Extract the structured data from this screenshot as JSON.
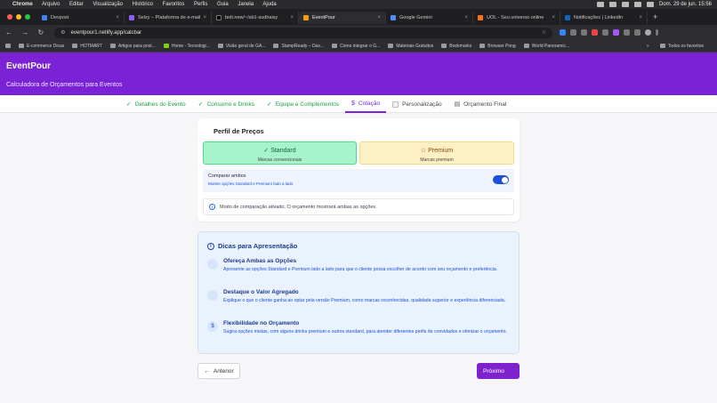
{
  "mac": {
    "menu": [
      "Chrome",
      "Arquivo",
      "Editar",
      "Visualização",
      "Histórico",
      "Favoritos",
      "Perfis",
      "Guia",
      "Janela",
      "Ajuda"
    ],
    "clock": "Dom. 29 de jun.  15:56"
  },
  "tabs": [
    {
      "label": "Devpost",
      "color": "#3b82f6"
    },
    {
      "label": "Selzy – Plataforma de e-mail",
      "color": "#8b5cf6"
    },
    {
      "label": "bolt.new/~/sb1-sudhaisy",
      "color": "#111111"
    },
    {
      "label": "EventPour",
      "color": "#f59e0b"
    },
    {
      "label": "Google Gemini",
      "color": "#4f8ef7"
    },
    {
      "label": "UOL - Seu universo online",
      "color": "#f97316"
    },
    {
      "label": "Notificações | LinkedIn",
      "color": "#0a66c2"
    }
  ],
  "address": {
    "url": "eventpour1.netlify.app/calcbar"
  },
  "bookmarks": [
    "E-commerce Dicas",
    "HOTMART",
    "Artigos para post...",
    "Home - Tecnologi...",
    "Visão geral de GA...",
    "StampReady – Das...",
    "Como integrar o G...",
    "Materiais Gratuitos",
    "Bookmarks",
    "Browser Pong",
    "World Panoramic..."
  ],
  "bookmarks_right": {
    "more": "»",
    "all": "Todos os favoritos"
  },
  "app": {
    "brand": "EventPour",
    "subtitle": "Calculadora de Orçamentos para Eventos"
  },
  "steps": [
    {
      "label": "Detalhes do Evento",
      "state": "done"
    },
    {
      "label": "Consumo e Drinks",
      "state": "done"
    },
    {
      "label": "Equipe e Complementos",
      "state": "done"
    },
    {
      "label": "Cotação",
      "state": "current"
    },
    {
      "label": "Personalização",
      "state": "todo"
    },
    {
      "label": "Orçamento Final",
      "state": "todo"
    }
  ],
  "pricing": {
    "title": "Perfil de Preços",
    "standard": {
      "name": "Standard",
      "desc": "Marcas convencionais"
    },
    "premium": {
      "name": "Premium",
      "desc": "Marcas premium"
    },
    "compare": {
      "label": "Comparar ambos",
      "desc": "Mostre opções Standard e Premium lado a lado",
      "enabled": true
    },
    "note": "Modo de comparação ativado. O orçamento mostrará ambas as opções."
  },
  "tips": {
    "title": "Dicas para Apresentação",
    "items": [
      {
        "title": "Ofereça Ambas as Opções",
        "text": "Apresente as opções Standard e Premium lado a lado para que o cliente possa escolher de acordo com seu orçamento e preferência."
      },
      {
        "title": "Destaque o Valor Agregado",
        "text": "Explique o que o cliente ganha ao optar pela versão Premium, como marcas reconhecidas, qualidade superior e experiência diferenciada."
      },
      {
        "title": "Flexibilidade no Orçamento",
        "text": "Sugira opções mistas, com alguns drinks premium e outros standard, para atender diferentes perfis de convidados e otimizar o orçamento."
      }
    ]
  },
  "nav": {
    "back": "Anterior",
    "next": "Próximo"
  },
  "colors": {
    "brand": "#7b22d6",
    "done": "#16a34a",
    "toggle": "#1d4ed8"
  }
}
